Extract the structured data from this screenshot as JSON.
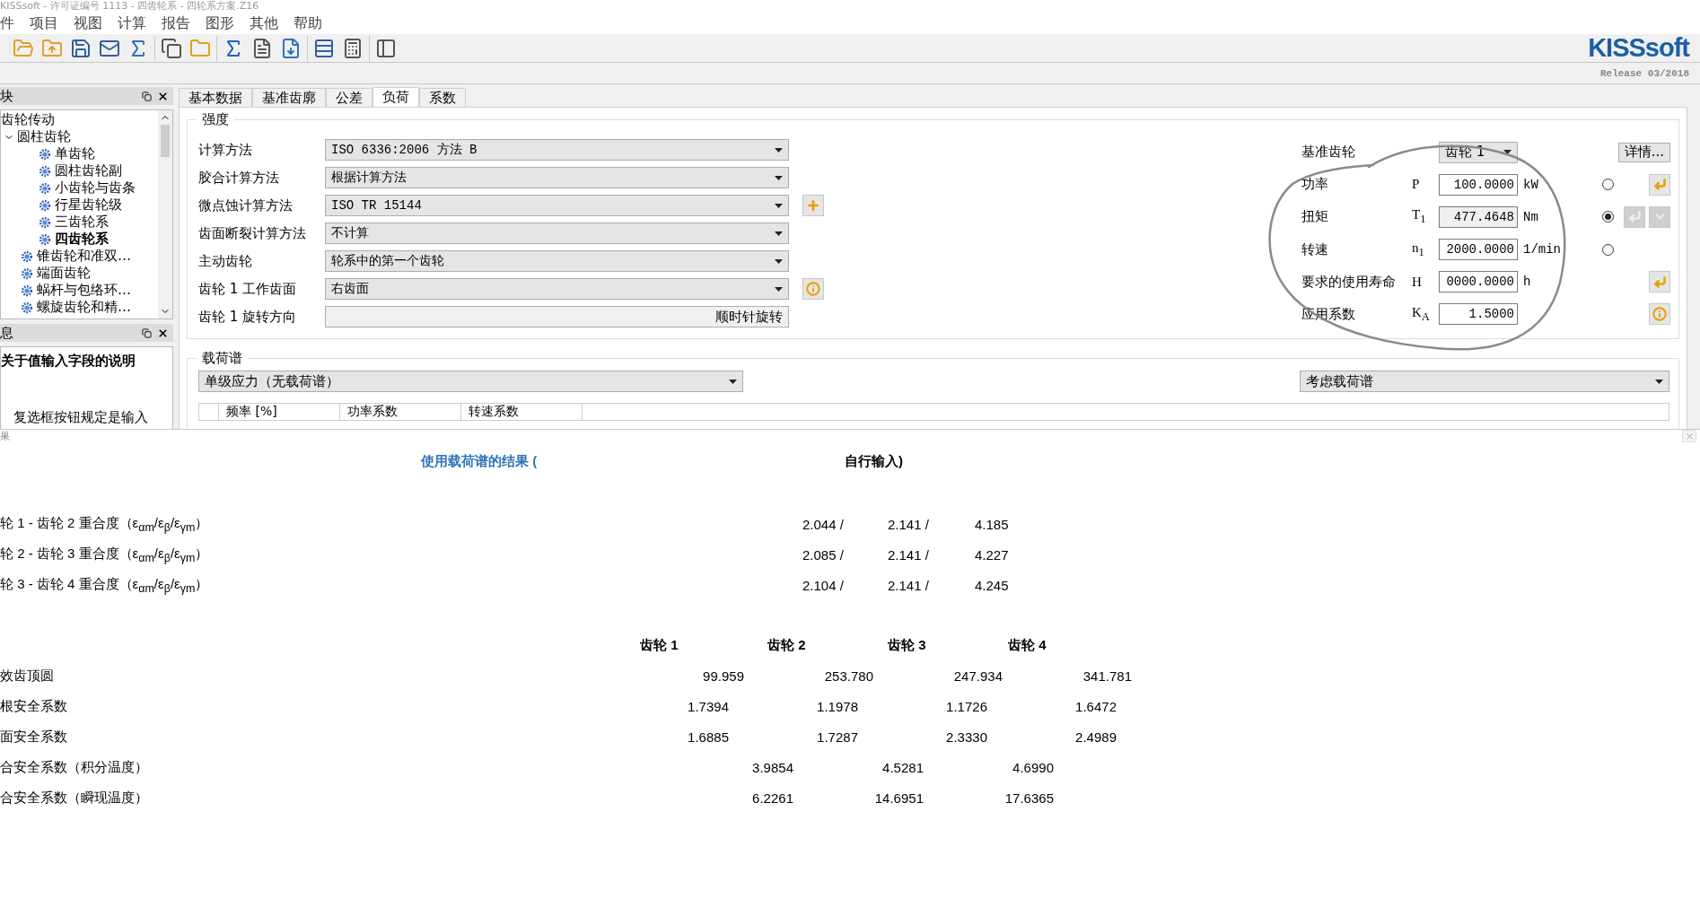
{
  "window": {
    "title": "KISSsoft - 许可证编号 1113 - 四齿轮系 - 四轮系方案.Z16"
  },
  "menu": [
    "件",
    "项目",
    "视图",
    "计算",
    "报告",
    "图形",
    "其他",
    "帮助"
  ],
  "logo": {
    "text": "KISSsoft",
    "release": "Release 03/2018"
  },
  "modules_panel": {
    "title": "块",
    "tree": [
      {
        "label": "齿轮传动",
        "selected": false,
        "children": [
          {
            "label": "圆柱齿轮",
            "selected": false,
            "expanded": true,
            "children": [
              {
                "label": "单齿轮",
                "selected": false
              },
              {
                "label": "圆柱齿轮副",
                "selected": false
              },
              {
                "label": "小齿轮与齿条",
                "selected": false
              },
              {
                "label": "行星齿轮级",
                "selected": false
              },
              {
                "label": "三齿轮系",
                "selected": false
              },
              {
                "label": "四齿轮系",
                "selected": true
              }
            ]
          },
          {
            "label": "锥齿轮和准双…",
            "selected": false
          },
          {
            "label": "端面齿轮",
            "selected": false
          },
          {
            "label": "蜗杆与包络环…",
            "selected": false
          },
          {
            "label": "螺旋齿轮和精…",
            "selected": false
          }
        ]
      }
    ]
  },
  "info_panel": {
    "title": "息",
    "heading": "关于值输入字段的说明",
    "text": "复选框按钮规定是输入"
  },
  "tabs": [
    {
      "label": "基本数据",
      "selected": false
    },
    {
      "label": "基准齿廓",
      "selected": false
    },
    {
      "label": "公差",
      "selected": false
    },
    {
      "label": "负荷",
      "selected": true
    },
    {
      "label": "系数",
      "selected": false
    }
  ],
  "strength": {
    "title": "强度",
    "rows": [
      {
        "label": "计算方法",
        "kind": "dropdown",
        "value": "ISO 6336:2006 方法 B"
      },
      {
        "label": "胶合计算方法",
        "kind": "dropdown",
        "value": "根据计算方法"
      },
      {
        "label": "微点蚀计算方法",
        "kind": "dropdown",
        "value": "ISO TR 15144",
        "buttons": [
          {
            "kind": "add",
            "disabled": false
          }
        ]
      },
      {
        "label": "齿面断裂计算方法",
        "kind": "dropdown",
        "value": "不计算"
      },
      {
        "label": "主动齿轮",
        "kind": "dropdown",
        "value": "轮系中的第一个齿轮"
      },
      {
        "label": "齿轮 1 工作齿面",
        "kind": "dropdown",
        "value": "右齿面",
        "buttons": [
          {
            "kind": "info",
            "disabled": false
          }
        ]
      },
      {
        "label": "齿轮 1 旋转方向",
        "kind": "display",
        "value": "顺时针旋转"
      }
    ]
  },
  "reference": {
    "label": "基准齿轮",
    "value": "齿轮 1",
    "details_button": "详情...",
    "rows": [
      {
        "label": "功率",
        "symbol": "P",
        "value": "100.0000",
        "unit": "kW",
        "kind": "radio",
        "selected": false,
        "readonly": false,
        "buttons": [
          {
            "kind": "apply",
            "disabled": false
          }
        ]
      },
      {
        "label": "扭矩",
        "symbol": "T$_{1}$",
        "value": "477.4648",
        "unit": "Nm",
        "kind": "radio",
        "selected": true,
        "readonly": true,
        "buttons": [
          {
            "kind": "apply",
            "disabled": true
          },
          {
            "kind": "convert",
            "disabled": true
          }
        ]
      },
      {
        "label": "转速",
        "symbol": "n$_{1}$",
        "value": "2000.0000",
        "unit": "1/min",
        "kind": "radio",
        "selected": false,
        "readonly": false
      },
      {
        "label": "要求的使用寿命",
        "symbol": "H",
        "value": "0000.0000",
        "unit": "h",
        "kind": "plain",
        "readonly": false,
        "buttons": [
          {
            "kind": "apply",
            "disabled": false
          }
        ]
      },
      {
        "label": "应用系数",
        "symbol": "K$_{A}$",
        "value": "1.5000",
        "kind": "plain",
        "readonly": false,
        "buttons": [
          {
            "kind": "info",
            "disabled": false
          }
        ]
      }
    ]
  },
  "load_spectrum": {
    "title": "载荷谱",
    "mode": "单级应力（无载荷谱）",
    "option": "考虑载荷谱",
    "columns": [
      "频率 [%]",
      "功率系数",
      "转速系数"
    ]
  },
  "results": {
    "title": "果",
    "heading": "使用载荷谱的结果 (",
    "heading_2": "自行输入)",
    "contact_ratios": [
      {
        "label": "轮 1 - 齿轮 2 重合度（ε$_{αm}$/ε$_{β}$/ε$_{γm}$）",
        "values": [
          "2.044 /",
          "2.141 /",
          "4.185"
        ]
      },
      {
        "label": "轮 2 - 齿轮 3 重合度（ε$_{αm}$/ε$_{β}$/ε$_{γm}$）",
        "values": [
          "2.085 /",
          "2.141 /",
          "4.227"
        ]
      },
      {
        "label": "轮 3 - 齿轮 4 重合度（ε$_{αm}$/ε$_{β}$/ε$_{γm}$）",
        "values": [
          "2.104 /",
          "2.141 /",
          "4.245"
        ]
      }
    ],
    "gears": [
      "齿轮 1",
      "齿轮 2",
      "齿轮 3",
      "齿轮 4"
    ],
    "rows": [
      {
        "label": "效齿顶圆",
        "kind": "diameter",
        "values": [
          "99.959",
          "253.780",
          "247.934",
          "341.781"
        ]
      },
      {
        "label": "根安全系数",
        "kind": "safety",
        "values": [
          "1.7394",
          "1.1978",
          "1.1726",
          "1.6472"
        ]
      },
      {
        "label": "面安全系数",
        "kind": "safety",
        "values": [
          "1.6885",
          "1.7287",
          "2.3330",
          "2.4989"
        ]
      },
      {
        "label": "合安全系数（积分温度）",
        "kind": "scuffing",
        "values": [
          "3.9854",
          "4.5281",
          "4.6990"
        ]
      },
      {
        "label": "合安全系数（瞬现温度）",
        "kind": "scuffing",
        "values": [
          "6.2261",
          "14.6951",
          "17.6365"
        ]
      }
    ]
  }
}
